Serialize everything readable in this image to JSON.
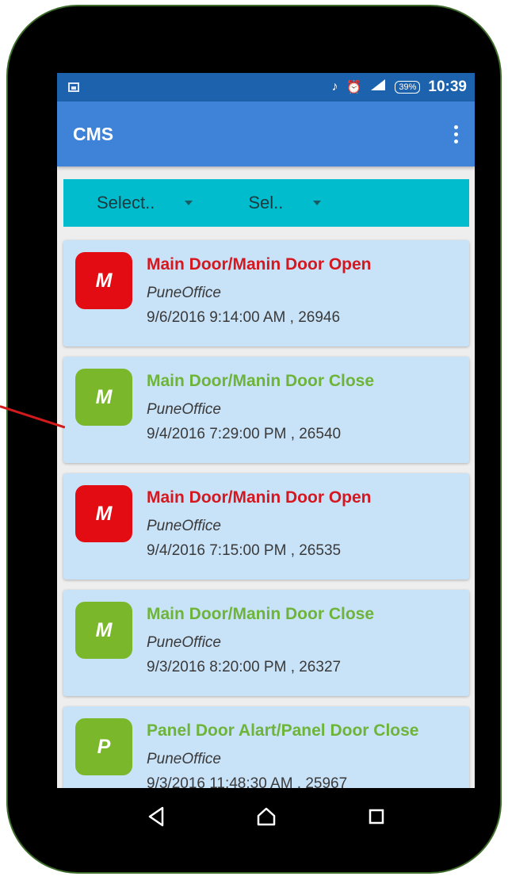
{
  "status_bar": {
    "icons": [
      "image-notification-icon",
      "dnd-icon",
      "alarm-icon",
      "signal-icon",
      "battery-icon"
    ],
    "battery": "39%",
    "time": "10:39"
  },
  "app_bar": {
    "title": "CMS"
  },
  "filters": {
    "select1": "Select..",
    "select2": "Sel.."
  },
  "events": [
    {
      "avatar": "M",
      "title": "Main Door/Manin Door Open",
      "location": "PuneOffice",
      "meta": "9/6/2016 9:14:00 AM , 26946",
      "status": "open"
    },
    {
      "avatar": "M",
      "title": "Main Door/Manin Door Close",
      "location": "PuneOffice",
      "meta": "9/4/2016 7:29:00 PM , 26540",
      "status": "close"
    },
    {
      "avatar": "M",
      "title": "Main Door/Manin Door Open",
      "location": "PuneOffice",
      "meta": "9/4/2016 7:15:00 PM , 26535",
      "status": "open"
    },
    {
      "avatar": "M",
      "title": "Main Door/Manin Door Close",
      "location": "PuneOffice",
      "meta": "9/3/2016 8:20:00 PM , 26327",
      "status": "close"
    },
    {
      "avatar": "P",
      "title": "Panel Door Alart/Panel Door Close",
      "location": "PuneOffice",
      "meta": "9/3/2016 11:48:30 AM , 25967",
      "status": "close"
    }
  ],
  "colors": {
    "status_bar": "#1d62ad",
    "app_bar": "#3e83d7",
    "filter_bar": "#00bccc",
    "card": "#c8e2f8",
    "open": "#e30c12",
    "close": "#7ab72a",
    "pointer_line": "#d21a1a"
  },
  "nav": {
    "icons": [
      "back-icon",
      "home-icon",
      "recents-icon"
    ]
  }
}
